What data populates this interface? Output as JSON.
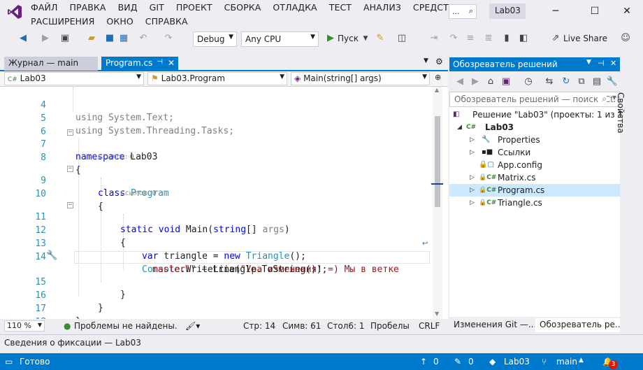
{
  "menu": {
    "row1": [
      "ФАЙЛ",
      "ПРАВКА",
      "ВИД",
      "GIT",
      "ПРОЕКТ",
      "СБОРКА",
      "ОТЛАДКА",
      "ТЕСТ",
      "АНАЛИЗ",
      "СРЕДСТВА"
    ],
    "row2": [
      "РАСШИРЕНИЯ",
      "ОКНО",
      "СПРАВКА"
    ]
  },
  "titlebar": {
    "search_text": "...",
    "solution_name": "Lab03"
  },
  "toolbar": {
    "config": "Debug",
    "platform": "Any CPU",
    "start_label": "Пуск",
    "live_share": "Live Share"
  },
  "doc_tabs": [
    {
      "label": "Журнал — main"
    },
    {
      "label": "Program.cs"
    }
  ],
  "nav_bar": {
    "project": "Lab03",
    "type": "Lab03.Program",
    "member": "Main(string[] args)"
  },
  "editor": {
    "lines": [
      {
        "n": "4",
        "code": "using System.Text;"
      },
      {
        "n": "5",
        "code": "using System.Threading.Tasks;"
      },
      {
        "n": "6",
        "code": ""
      },
      {
        "n": "7",
        "code": "namespace Lab03"
      },
      {
        "n": "8",
        "code": "{"
      },
      {
        "n": "9",
        "code": "class Program"
      },
      {
        "n": "10",
        "code": "{"
      },
      {
        "n": "11",
        "code": "static void Main(string[] args)"
      },
      {
        "n": "12",
        "code": "{"
      },
      {
        "n": "13",
        "code": "var triangle = new Triangle();"
      },
      {
        "n": "14",
        "code": "Console.WriteLine(\"Ура изменения! =) Мы в ветке"
      },
      {
        "n": "",
        "code": "master!\" + triangle.ToString());"
      },
      {
        "n": "15",
        "code": "}"
      },
      {
        "n": "16",
        "code": "}"
      },
      {
        "n": "17",
        "code": "}"
      },
      {
        "n": "18",
        "code": ""
      }
    ],
    "ref_class": "Ссылок: 0",
    "ref_method": "Ссылок: 0"
  },
  "editor_status": {
    "zoom": "110 %",
    "problems": "Проблемы не найдены.",
    "line": "Стр: 14",
    "char": "Симв: 61",
    "col": "Стол6: 1",
    "spaces": "Пробелы",
    "eol": "CRLF"
  },
  "solution_explorer": {
    "title": "Обозреватель решений",
    "search_placeholder": "Обозреватель решений — поиск (Ctrl+;)",
    "solution": "Решение \"Lab03\" (проекты: 1 из 1)",
    "project": "Lab03",
    "items": [
      "Properties",
      "Ссылки",
      "App.config",
      "Matrix.cs",
      "Program.cs",
      "Triangle.cs"
    ],
    "tabs": [
      "Изменения Git —...",
      "Обозреватель ре..."
    ]
  },
  "side_panel": {
    "label": "Свойства"
  },
  "commit_panel": {
    "label": "Сведения о фиксации — Lab03"
  },
  "statusbar": {
    "ready": "Готово",
    "up": "0",
    "edits": "0",
    "repo": "Lab03",
    "branch": "main",
    "notifications": "3"
  },
  "colors": {
    "accent": "#007ACC",
    "keyword": "#0000FF",
    "type": "#2B91AF",
    "string": "#A31515",
    "badge": "#E51400"
  }
}
